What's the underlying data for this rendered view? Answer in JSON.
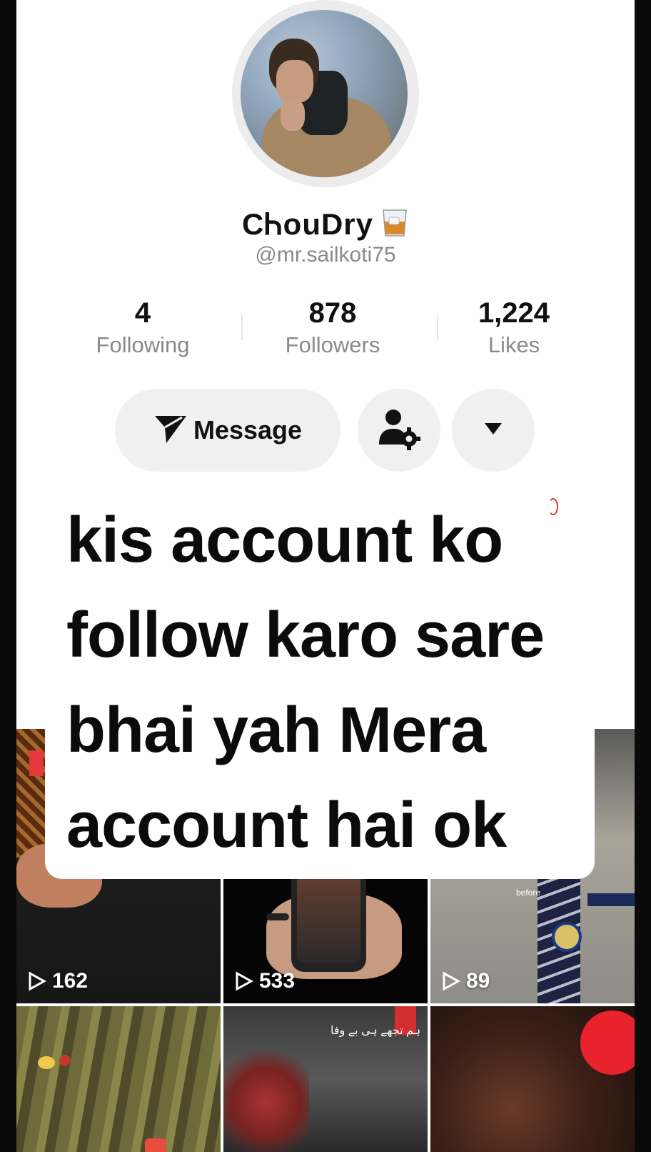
{
  "profile": {
    "display_name": "CᏂouDry",
    "username": "@mr.sailkoti75",
    "stats": [
      {
        "value": "4",
        "label": "Following"
      },
      {
        "value": "878",
        "label": "Followers"
      },
      {
        "value": "1,224",
        "label": "Likes"
      }
    ]
  },
  "actions": {
    "message_label": "Message",
    "message_icon": "send-icon",
    "add_friend_icon": "user-settings-icon",
    "more_icon": "caret-down-icon"
  },
  "caption": {
    "lines": [
      "kis account ko",
      "follow karo sare",
      "bhai yah Mera",
      "account hai ok"
    ]
  },
  "videos": [
    {
      "views": "162",
      "overlay_text": ""
    },
    {
      "views": "533",
      "overlay_text": ""
    },
    {
      "views": "89",
      "overlay_text": "before"
    },
    {
      "views": "",
      "overlay_text": ""
    },
    {
      "views": "",
      "overlay_text": "ہم تجھے ہی بے وفا"
    },
    {
      "views": "",
      "overlay_text": ""
    }
  ]
}
